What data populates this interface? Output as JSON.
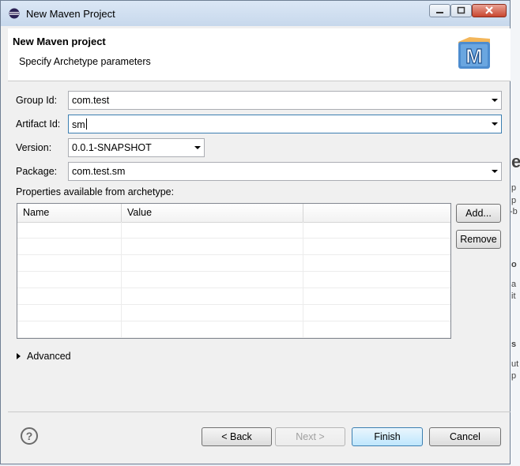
{
  "window": {
    "title": "New Maven Project"
  },
  "header": {
    "title": "New Maven project",
    "subtitle": "Specify Archetype parameters",
    "logo_letter": "M"
  },
  "form": {
    "group_id": {
      "label": "Group Id:",
      "value": "com.test"
    },
    "artifact_id": {
      "label": "Artifact Id:",
      "value": "sm"
    },
    "version": {
      "label": "Version:",
      "value": "0.0.1-SNAPSHOT"
    },
    "package": {
      "label": "Package:",
      "value": "com.test.sm"
    }
  },
  "properties": {
    "label": "Properties available from archetype:",
    "columns": [
      "Name",
      "Value",
      ""
    ],
    "rows": []
  },
  "buttons": {
    "add": "Add...",
    "remove": "Remove",
    "back": "< Back",
    "next": "Next >",
    "finish": "Finish",
    "cancel": "Cancel"
  },
  "advanced_label": "Advanced",
  "background_fragments": [
    "e",
    "p",
    "p",
    "-b",
    "o",
    "a",
    "it",
    "s",
    "ut",
    "p"
  ],
  "icons": {
    "app": "eclipse-icon",
    "help": "help-icon",
    "logo": "maven-logo-icon"
  }
}
